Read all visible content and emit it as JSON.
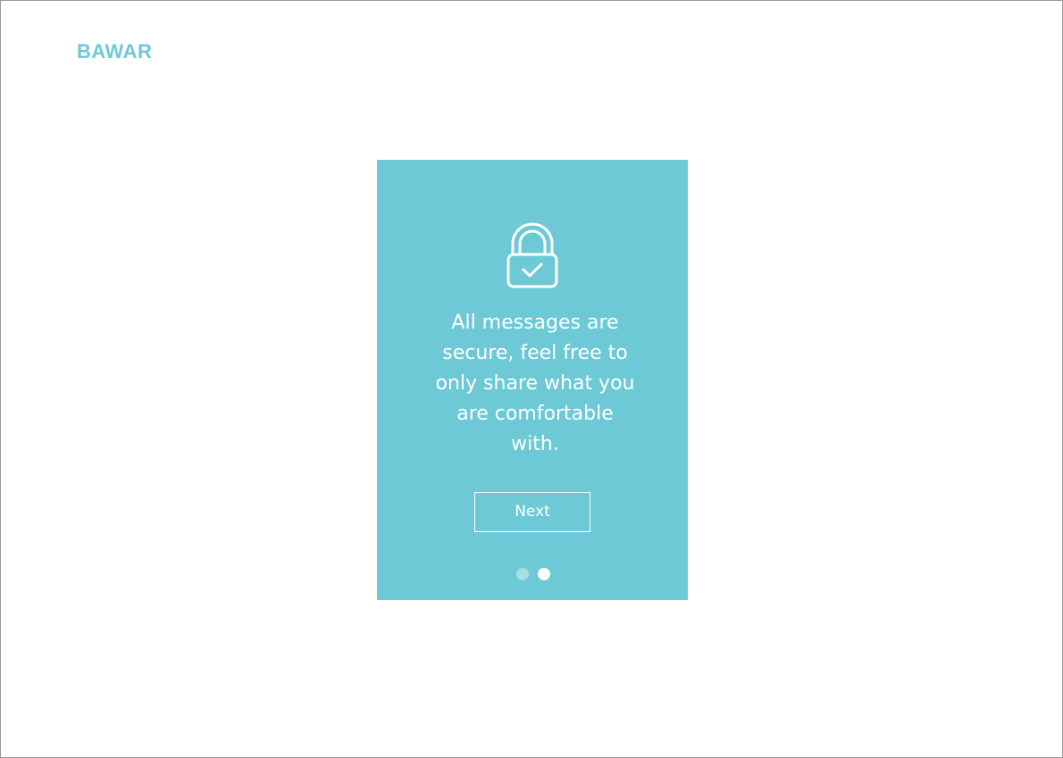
{
  "brand": {
    "name": "BAWAR"
  },
  "colors": {
    "accent": "#6DC9D6",
    "dot_inactive": "#A9DDE5"
  },
  "onboarding": {
    "icon": "lock-check-icon",
    "message": "All messages are secure, feel free to only share what you are comfortable with.",
    "next_label": "Next",
    "pagination": {
      "total": 2,
      "current": 2
    }
  }
}
